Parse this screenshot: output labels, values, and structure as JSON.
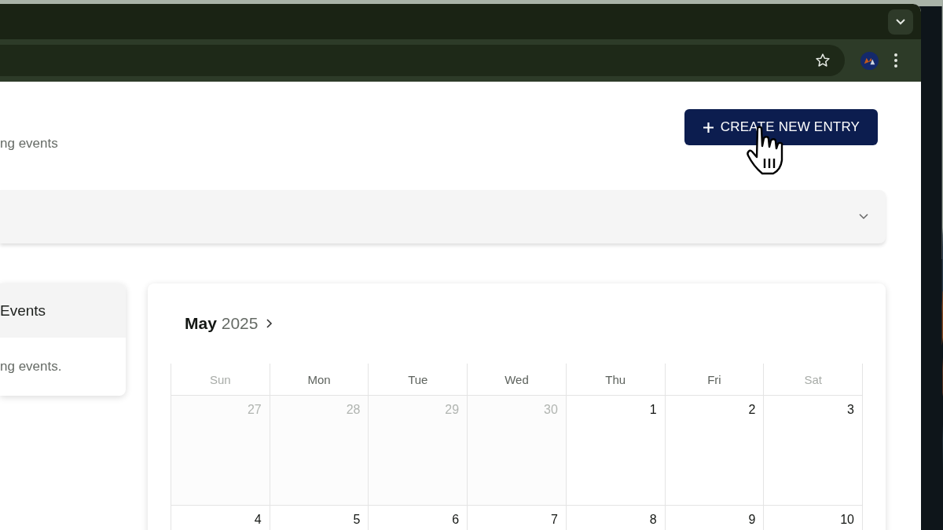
{
  "header": {
    "subtitle": "ng events",
    "create_button": "CREATE NEW ENTRY"
  },
  "events_card": {
    "title": "Events",
    "message": "ng events."
  },
  "calendar": {
    "month": "May",
    "year": "2025",
    "weekdays": [
      {
        "label": "Sun",
        "weekend": true
      },
      {
        "label": "Mon",
        "weekend": false
      },
      {
        "label": "Tue",
        "weekend": false
      },
      {
        "label": "Wed",
        "weekend": false
      },
      {
        "label": "Thu",
        "weekend": false
      },
      {
        "label": "Fri",
        "weekend": false
      },
      {
        "label": "Sat",
        "weekend": true
      }
    ],
    "weeks": [
      [
        {
          "day": "27",
          "outside": true
        },
        {
          "day": "28",
          "outside": true
        },
        {
          "day": "29",
          "outside": true
        },
        {
          "day": "30",
          "outside": true
        },
        {
          "day": "1",
          "outside": false
        },
        {
          "day": "2",
          "outside": false
        },
        {
          "day": "3",
          "outside": false
        }
      ],
      [
        {
          "day": "4",
          "outside": false
        },
        {
          "day": "5",
          "outside": false
        },
        {
          "day": "6",
          "outside": false
        },
        {
          "day": "7",
          "outside": false
        },
        {
          "day": "8",
          "outside": false
        },
        {
          "day": "9",
          "outside": false
        },
        {
          "day": "10",
          "outside": false
        }
      ]
    ]
  }
}
